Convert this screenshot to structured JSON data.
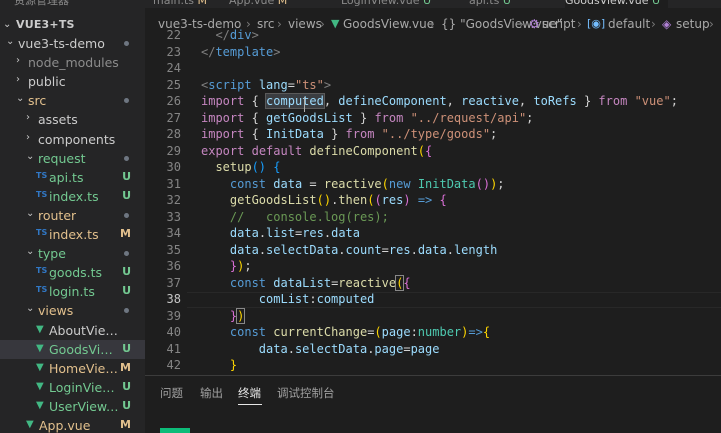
{
  "sidebar": {
    "top_cut_text": "资源管理器",
    "workspace_title": "VUE3+TS",
    "tree": [
      {
        "label": "vue3-ts-demo",
        "depth": 1,
        "kind": "folder-open",
        "status": "dot",
        "color": "#cccccc"
      },
      {
        "label": "node_modules",
        "depth": 2,
        "kind": "folder-closed",
        "status": "",
        "color": "#8c8c8c"
      },
      {
        "label": "public",
        "depth": 2,
        "kind": "folder-closed",
        "status": "",
        "color": "#cccccc"
      },
      {
        "label": "src",
        "depth": 2,
        "kind": "folder-open",
        "status": "dot",
        "color": "#e2c08d"
      },
      {
        "label": "assets",
        "depth": 3,
        "kind": "folder-closed",
        "status": "",
        "color": "#cccccc"
      },
      {
        "label": "components",
        "depth": 3,
        "kind": "folder-closed",
        "status": "",
        "color": "#cccccc"
      },
      {
        "label": "request",
        "depth": 3,
        "kind": "folder-open",
        "status": "dot",
        "color": "#73c991"
      },
      {
        "label": "api.ts",
        "depth": 4,
        "kind": "ts",
        "status": "U",
        "color": "#73c991"
      },
      {
        "label": "index.ts",
        "depth": 4,
        "kind": "ts",
        "status": "U",
        "color": "#73c991"
      },
      {
        "label": "router",
        "depth": 3,
        "kind": "folder-open",
        "status": "dot",
        "color": "#e2c08d"
      },
      {
        "label": "index.ts",
        "depth": 4,
        "kind": "ts",
        "status": "M",
        "color": "#e2c08d"
      },
      {
        "label": "type",
        "depth": 3,
        "kind": "folder-open",
        "status": "dot",
        "color": "#73c991"
      },
      {
        "label": "goods.ts",
        "depth": 4,
        "kind": "ts",
        "status": "U",
        "color": "#73c991"
      },
      {
        "label": "login.ts",
        "depth": 4,
        "kind": "ts",
        "status": "U",
        "color": "#73c991"
      },
      {
        "label": "views",
        "depth": 3,
        "kind": "folder-open",
        "status": "dot",
        "color": "#e2c08d"
      },
      {
        "label": "AboutView.vue",
        "depth": 4,
        "kind": "vue",
        "status": "",
        "color": "#cccccc"
      },
      {
        "label": "GoodsView....",
        "depth": 4,
        "kind": "vue",
        "status": "U",
        "color": "#73c991",
        "selected": true
      },
      {
        "label": "HomeView....",
        "depth": 4,
        "kind": "vue",
        "status": "M",
        "color": "#e2c08d"
      },
      {
        "label": "LoginView.vue",
        "depth": 4,
        "kind": "vue",
        "status": "U",
        "color": "#73c991"
      },
      {
        "label": "UserView.vue",
        "depth": 4,
        "kind": "vue",
        "status": "U",
        "color": "#73c991"
      },
      {
        "label": "App.vue",
        "depth": 3,
        "kind": "vue",
        "status": "M",
        "color": "#e2c08d"
      }
    ]
  },
  "editor": {
    "tabs": [
      {
        "label": "main.ts",
        "status": "M"
      },
      {
        "label": "App.vue",
        "status": "M"
      },
      {
        "label": "LoginView.vue",
        "status": "U"
      },
      {
        "label": "api.ts",
        "status": "U"
      },
      {
        "label": "GoodsView.vue",
        "status": "U"
      }
    ],
    "breadcrumb": [
      "vue3-ts-demo",
      "src",
      "views",
      "GoodsView.vue",
      "{} \"GoodsView.vue\"",
      "script",
      "default",
      "setup"
    ],
    "line_numbers": [
      "22",
      "23",
      "24",
      "25",
      "26",
      "27",
      "28",
      "29",
      "30",
      "31",
      "32",
      "33",
      "34",
      "35",
      "36",
      "37",
      "38",
      "39",
      "40",
      "41",
      "42"
    ],
    "current_line": "38"
  },
  "panel": {
    "tabs": [
      "问题",
      "输出",
      "终端",
      "调试控制台"
    ],
    "active_tab": "终端"
  },
  "colors": {
    "accent": "#007acc",
    "untracked": "#73c991",
    "modified": "#e2c08d",
    "keyword": "#569cd6",
    "control_keyword": "#c586c0",
    "string": "#ce9178",
    "function": "#dcdcaa",
    "variable": "#9cdcfe",
    "type": "#4ec9b0",
    "comment": "#6a9955"
  }
}
